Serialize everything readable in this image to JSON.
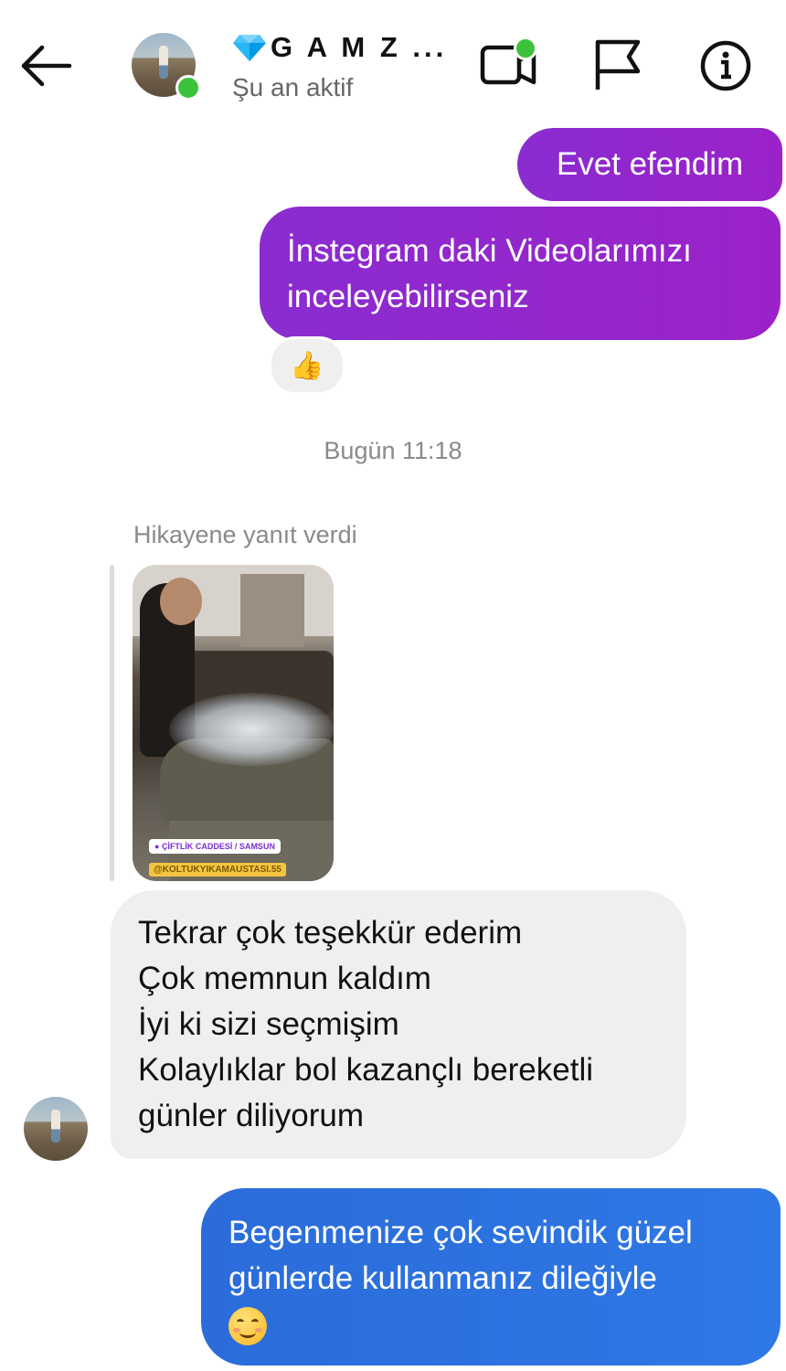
{
  "header": {
    "contact_name": "G A M Z ...",
    "status": "Şu an aktif",
    "icons": [
      "back-arrow-icon",
      "avatar",
      "gem-icon",
      "video-call-icon",
      "flag-icon",
      "info-icon"
    ],
    "accent_online": "#3cc13b"
  },
  "messages": [
    {
      "direction": "outgoing",
      "text": "Evet efendim",
      "color": "#9b22c9"
    },
    {
      "direction": "outgoing",
      "lines": [
        "İnstegram daki Videolarımızı",
        "inceleyebilirseniz"
      ],
      "color": "#9b22c9",
      "reaction": "👍"
    },
    {
      "type": "timestamp",
      "text": "Bugün 11:18"
    },
    {
      "type": "story_reply",
      "label": "Hikayene yanıt verdi",
      "story_location": "ÇİFTLİK CADDESİ / SAMSUN",
      "story_handle": "@KOLTUKYIKAMAUSTASI.55"
    },
    {
      "direction": "incoming",
      "lines": [
        "Tekrar çok teşekkür ederim",
        "Çok memnun kaldım",
        "İyi ki sizi seçmişim",
        "Kolaylıklar bol kazançlı bereketli",
        "günler diliyorum"
      ],
      "color": "#efefef"
    },
    {
      "direction": "outgoing",
      "lines": [
        "Begenmenize çok sevindik güzel",
        "günlerde kullanmanız dileğiyle"
      ],
      "emoji": "smiling-face",
      "color": "#2e78e6"
    }
  ]
}
